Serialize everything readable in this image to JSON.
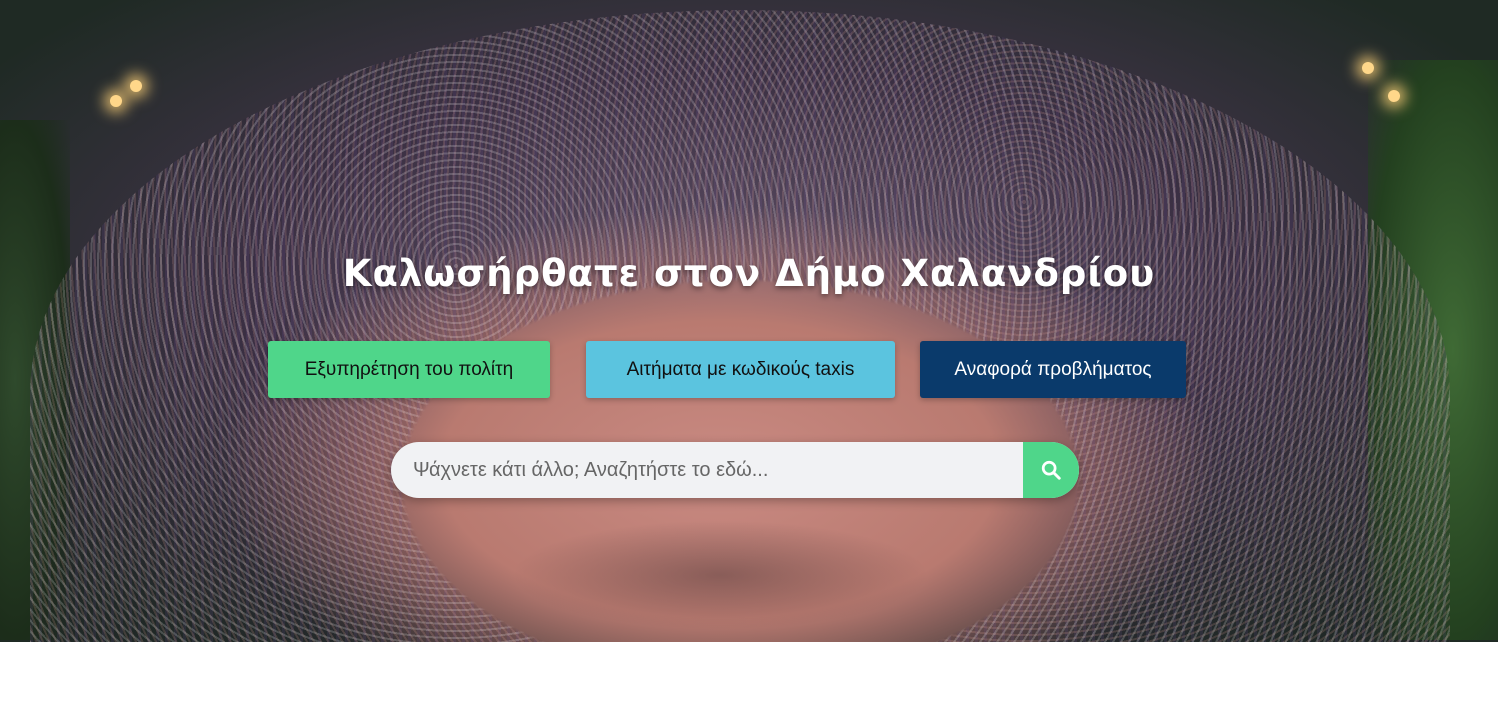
{
  "hero": {
    "title": "Καλωσήρθατε στον Δήμο Χαλανδρίου",
    "background_icon": "amphitheater-photo"
  },
  "actions": {
    "citizen_service": "Εξυπηρέτηση του πολίτη",
    "taxis_requests": "Αιτήματα με κωδικούς taxis",
    "report_problem": "Αναφορά προβλήματος"
  },
  "search": {
    "placeholder": "Ψάχνετε κάτι άλλο; Αναζητήστε το εδώ...",
    "icon": "search-icon"
  },
  "colors": {
    "green": "#4fd68a",
    "light_blue": "#5bc4df",
    "dark_blue": "#0a3a6b"
  }
}
